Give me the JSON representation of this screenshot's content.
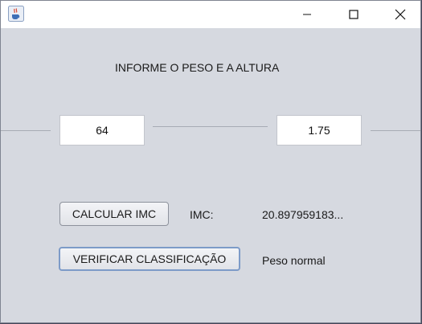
{
  "window": {
    "title": "",
    "controls": {
      "minimize": "minimize-icon",
      "maximize": "maximize-icon",
      "close": "close-icon"
    },
    "app_icon": "java-cup-icon"
  },
  "form": {
    "heading": "INFORME O PESO E A ALTURA",
    "peso_value": "64",
    "altura_value": "1.75",
    "calcular_label": "CALCULAR IMC",
    "imc_label": "IMC:",
    "imc_value": "20.897959183...",
    "verificar_label": "VERIFICAR CLASSIFICAÇÃO",
    "classificacao_value": "Peso normal"
  },
  "colors": {
    "panel_background": "#d6d9e0",
    "titlebar_background": "#ffffff",
    "focus_border": "#7d9bc8"
  }
}
